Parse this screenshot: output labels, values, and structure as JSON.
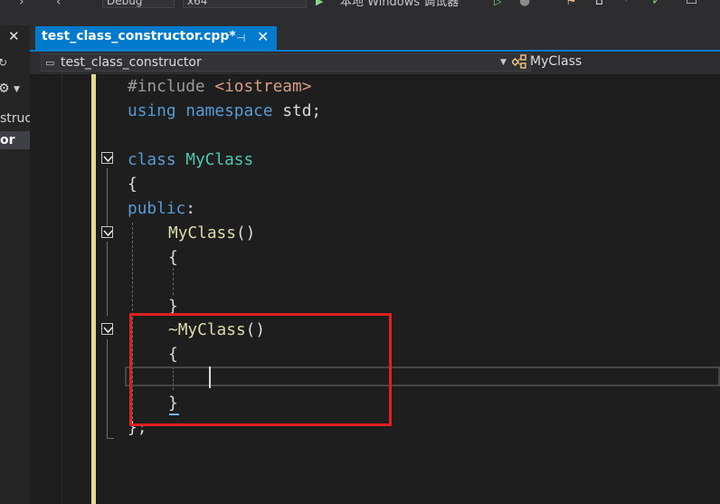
{
  "toolbar": {
    "config_label": "Debug",
    "platform_label": "x64",
    "run_label": "本地 Windows 调试器",
    "play_icon": "play-icon",
    "settings_icon": "settings-icon"
  },
  "left_panel": {
    "close_glyph": "✕",
    "item_partial_1": "struc",
    "item_partial_2": "or"
  },
  "tab": {
    "title": "test_class_constructor.cpp*",
    "pin_glyph": "⊣",
    "close_glyph": "✕",
    "accent_color": "#007acc"
  },
  "navbar": {
    "scope": "test_class_constructor",
    "member": "MyClass"
  },
  "code": {
    "include_directive": "#include",
    "include_header": "<iostream>",
    "using_kw": "using",
    "namespace_kw": "namespace",
    "std_text": " std;",
    "class_kw": "class",
    "class_name": "MyClass",
    "open_brace": "{",
    "public_kw": "public",
    "colon": ":",
    "ctor_name": "MyClass",
    "parens": "()",
    "ctor_open": "{",
    "ctor_close": "}",
    "dtor_tilde": "~",
    "dtor_name": "MyClass",
    "dtor_open": "{",
    "dtor_close": "}",
    "class_close": "};"
  }
}
